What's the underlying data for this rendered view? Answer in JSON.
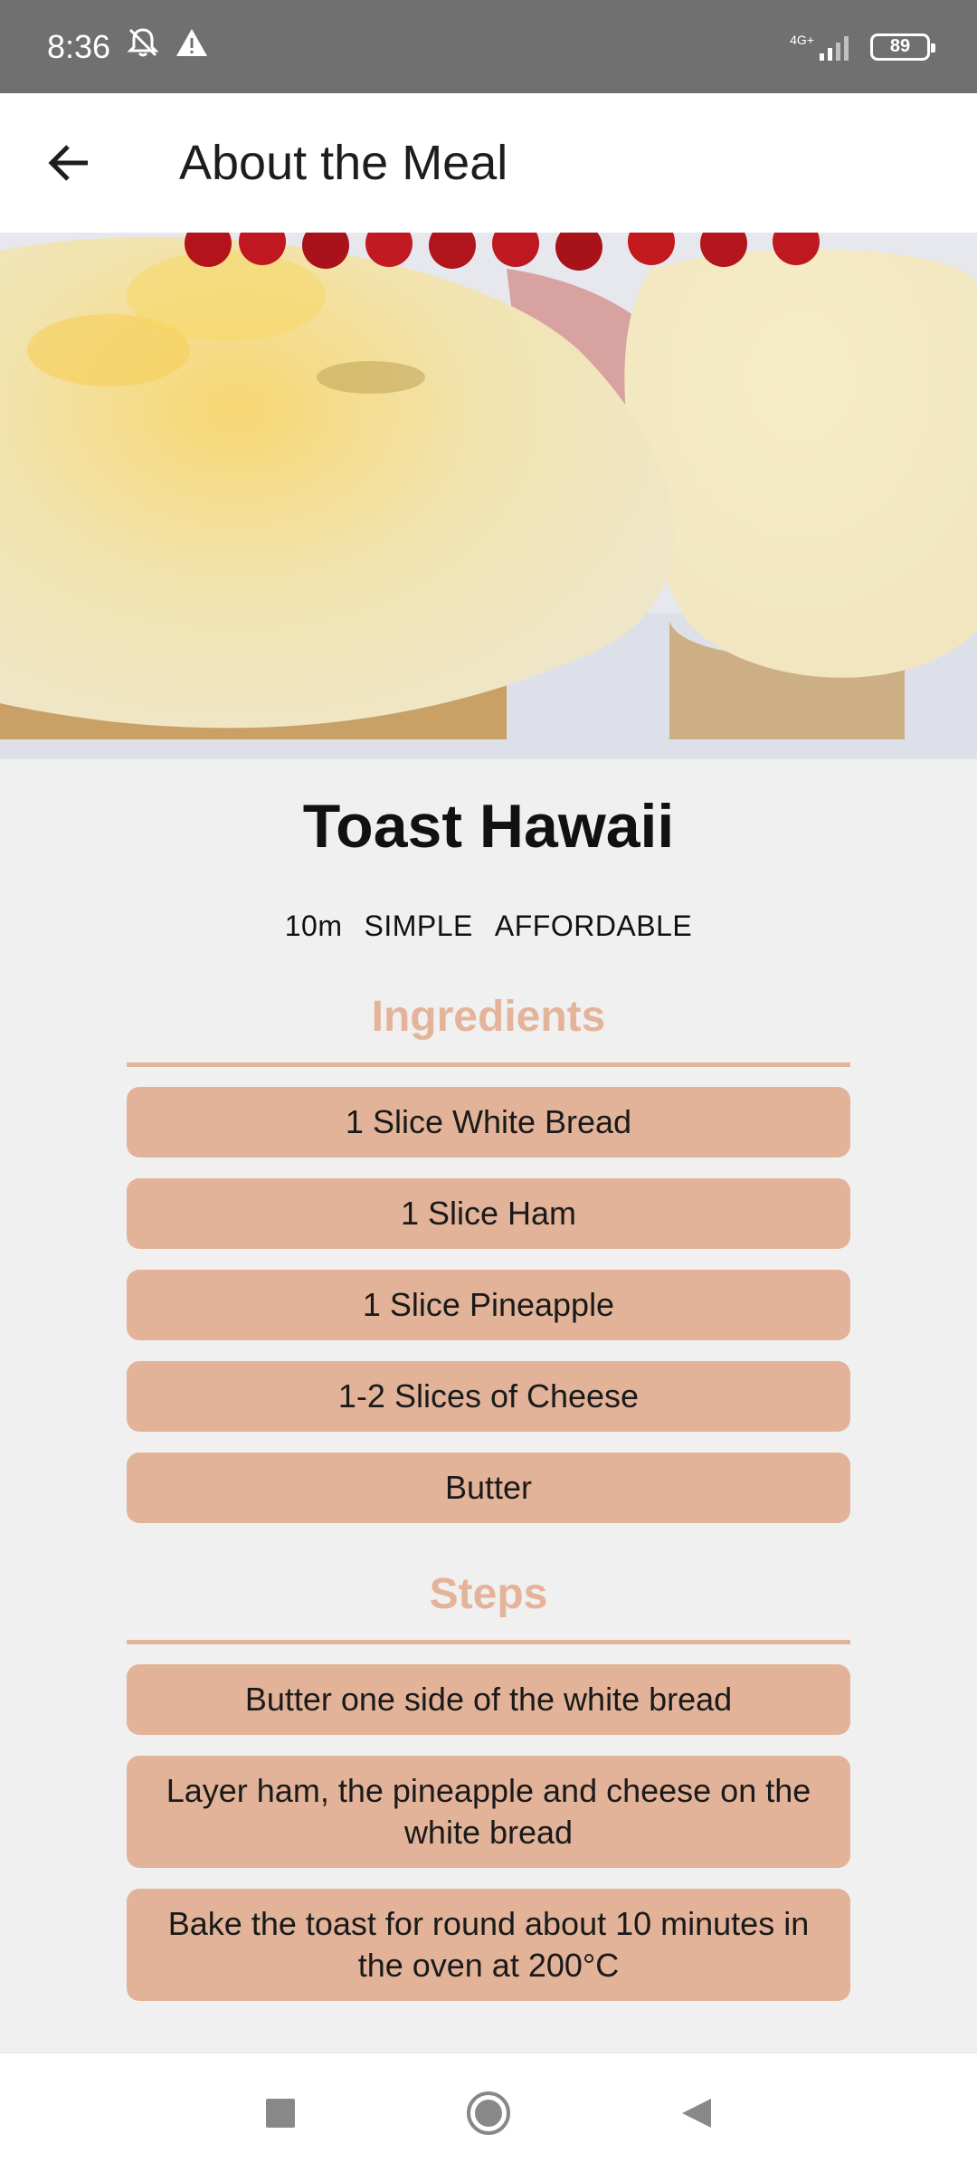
{
  "status_bar": {
    "time": "8:36",
    "network_label": "4G+",
    "battery": "89",
    "icons": [
      "muted-bell-icon",
      "warning-icon",
      "signal-icon",
      "battery-icon"
    ]
  },
  "app_bar": {
    "title": "About the Meal",
    "back_icon": "arrow-left-icon"
  },
  "hero": {
    "image": "toast-hawaii-photo"
  },
  "meal": {
    "title": "Toast Hawaii",
    "duration": "10m",
    "complexity": "SIMPLE",
    "affordability": "AFFORDABLE"
  },
  "ingredients": {
    "heading": "Ingredients",
    "items": [
      "1 Slice White Bread",
      "1 Slice Ham",
      "1 Slice Pineapple",
      "1-2 Slices of Cheese",
      "Butter"
    ]
  },
  "steps": {
    "heading": "Steps",
    "items": [
      "Butter one side of the white bread",
      "Layer ham, the pineapple and cheese on the white bread",
      "Bake the toast for round about 10 minutes in the oven at 200°C"
    ]
  },
  "nav_bar": {
    "icons": [
      "recents-square-icon",
      "home-circle-icon",
      "back-triangle-icon"
    ]
  },
  "colors": {
    "accent": "#e4b49a",
    "item_bg": "#e2b398",
    "status_bar": "#707070",
    "background": "#f0f0f0"
  }
}
